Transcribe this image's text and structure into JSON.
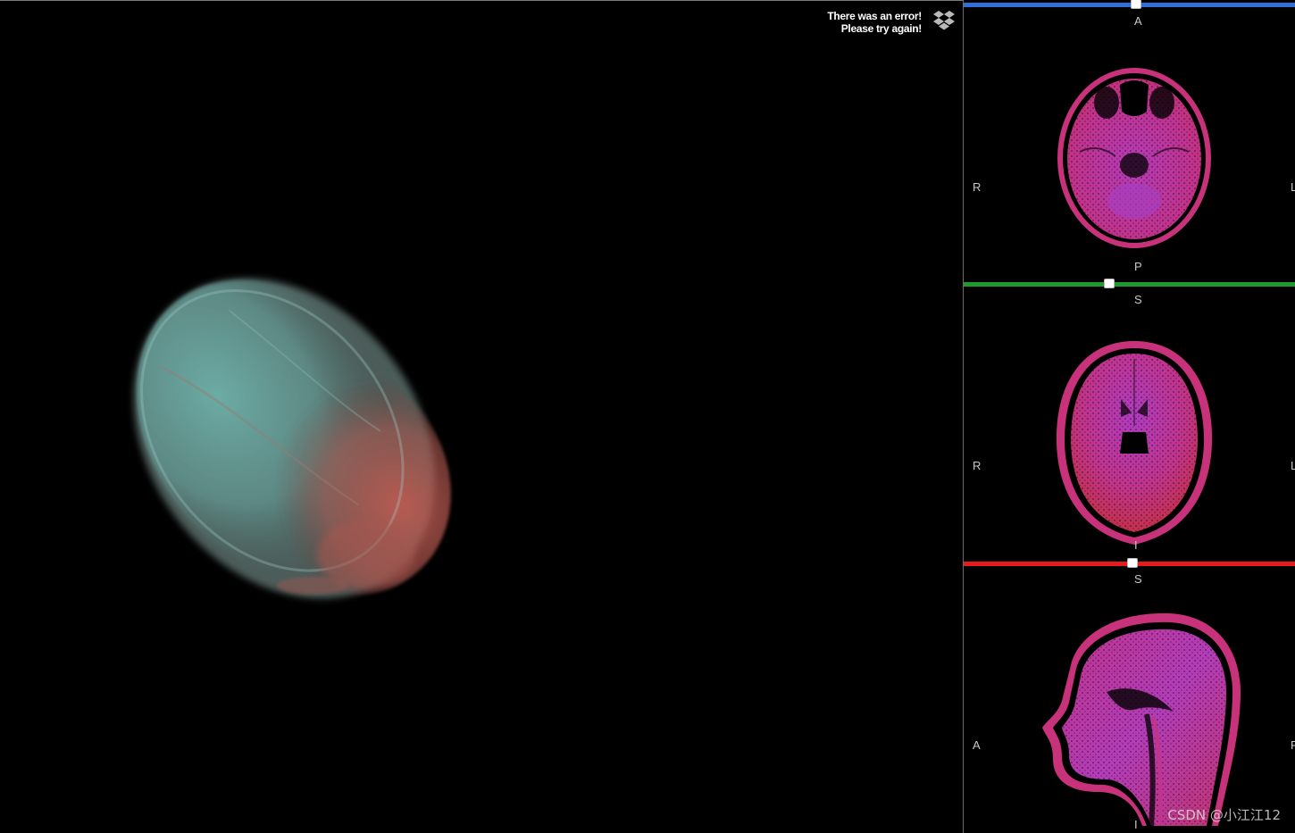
{
  "error": {
    "line1": "There was an error!",
    "line2": "Please try again!",
    "icon": "dropbox-icon"
  },
  "panels": {
    "axial": {
      "slider_color": "#2f6fd6",
      "slider_position": 0.52,
      "top_label": "A",
      "bottom_label": "P",
      "left_label": "R",
      "right_label": "L"
    },
    "coronal": {
      "slider_color": "#1f9a2c",
      "slider_position": 0.44,
      "top_label": "S",
      "bottom_label": "I",
      "left_label": "R",
      "right_label": "L"
    },
    "sagittal": {
      "slider_color": "#e81b1b",
      "slider_position": 0.51,
      "top_label": "S",
      "bottom_label": "I",
      "left_label": "A",
      "right_label": "P"
    }
  },
  "watermark": "CSDN @小江江12",
  "colors": {
    "background": "#000000",
    "slice_tint": "#c03090",
    "volume_teal": "#6fb3ae",
    "volume_red": "#b5574f"
  }
}
